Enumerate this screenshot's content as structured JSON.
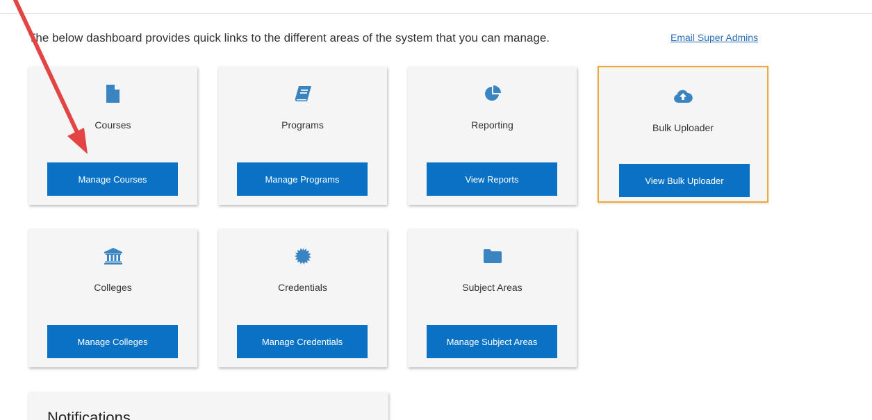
{
  "intro": {
    "text": "The below dashboard provides quick links to the different areas of the system that you can manage."
  },
  "header": {
    "email_link": "Email Super Admins"
  },
  "cards": [
    {
      "title": "Courses",
      "button": "Manage Courses",
      "icon": "file-icon"
    },
    {
      "title": "Programs",
      "button": "Manage Programs",
      "icon": "book-icon"
    },
    {
      "title": "Reporting",
      "button": "View Reports",
      "icon": "pie-chart-icon"
    },
    {
      "title": "Bulk Uploader",
      "button": "View Bulk Uploader",
      "icon": "cloud-upload-icon"
    },
    {
      "title": "Colleges",
      "button": "Manage Colleges",
      "icon": "institution-icon"
    },
    {
      "title": "Credentials",
      "button": "Manage Credentials",
      "icon": "certificate-icon"
    },
    {
      "title": "Subject Areas",
      "button": "Manage Subject Areas",
      "icon": "folder-icon"
    }
  ],
  "notifications": {
    "heading": "Notifications"
  },
  "colors": {
    "button": "#0a72c4",
    "icon": "#3a84c2",
    "highlight_border": "#f0a838",
    "annotation_arrow": "#e34545"
  }
}
